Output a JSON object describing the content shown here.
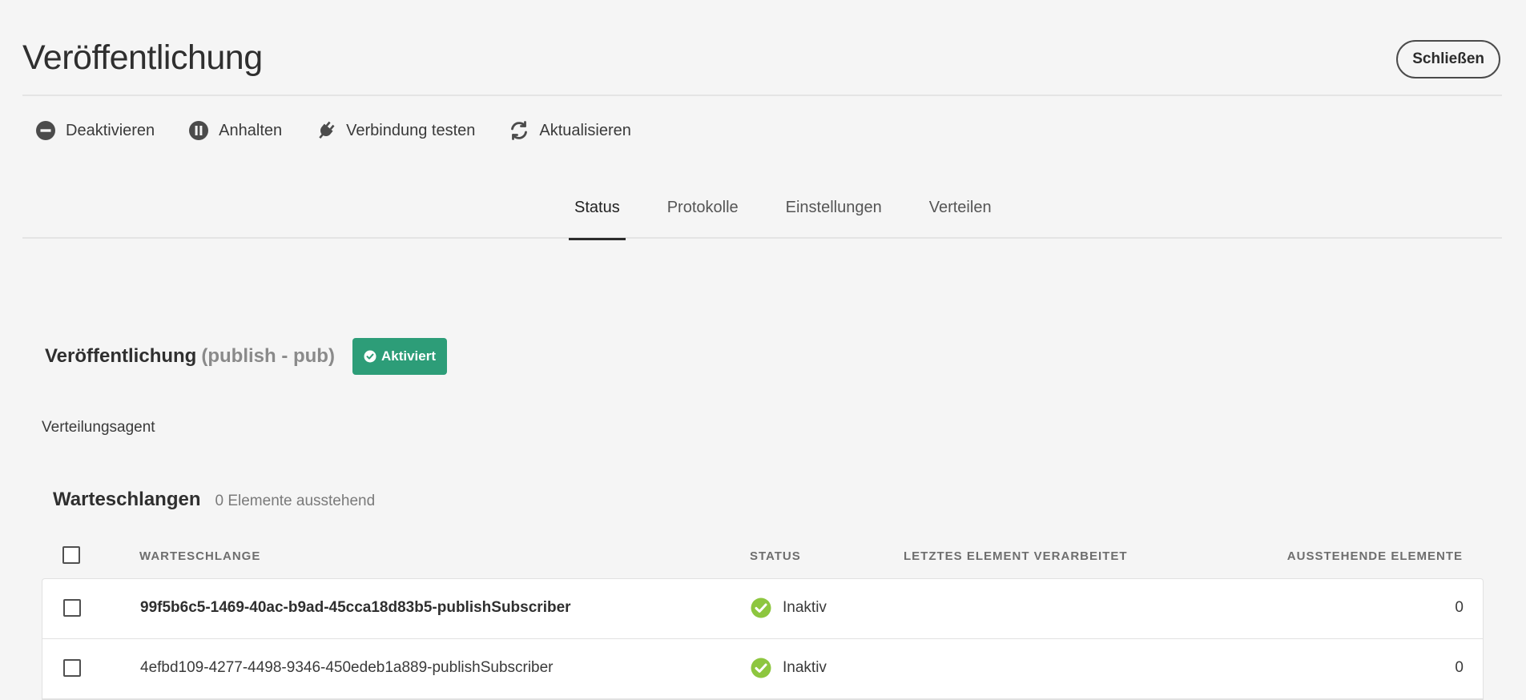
{
  "header": {
    "title": "Veröffentlichung",
    "close_label": "Schließen"
  },
  "toolbar": {
    "items": [
      {
        "label": "Deaktivieren",
        "icon": "minus-circle-icon"
      },
      {
        "label": "Anhalten",
        "icon": "pause-circle-icon"
      },
      {
        "label": "Verbindung testen",
        "icon": "plug-icon"
      },
      {
        "label": "Aktualisieren",
        "icon": "refresh-icon"
      }
    ]
  },
  "tabs": [
    {
      "label": "Status",
      "active": true
    },
    {
      "label": "Protokolle",
      "active": false
    },
    {
      "label": "Einstellungen",
      "active": false
    },
    {
      "label": "Verteilen",
      "active": false
    }
  ],
  "agent": {
    "title": "Veröffentlichung",
    "subtitle": "(publish - pub)",
    "badge": "Aktiviert",
    "badge_color": "#2d9d78",
    "type": "Verteilungsagent"
  },
  "queues": {
    "title": "Warteschlangen",
    "pending": "0 Elemente ausstehend",
    "columns": {
      "queue": "WARTESCHLANGE",
      "status": "STATUS",
      "last": "LETZTES ELEMENT VERARBEITET",
      "pending": "AUSSTEHENDE ELEMENTE"
    },
    "rows": [
      {
        "name": "99f5b6c5-1469-40ac-b9ad-45cca18d83b5-publishSubscriber",
        "status": "Inaktiv",
        "last": "",
        "pending": "0"
      },
      {
        "name": "4efbd109-4277-4498-9346-450edeb1a889-publishSubscriber",
        "status": "Inaktiv",
        "last": "",
        "pending": "0"
      }
    ],
    "status_color": "#8dc63f"
  }
}
